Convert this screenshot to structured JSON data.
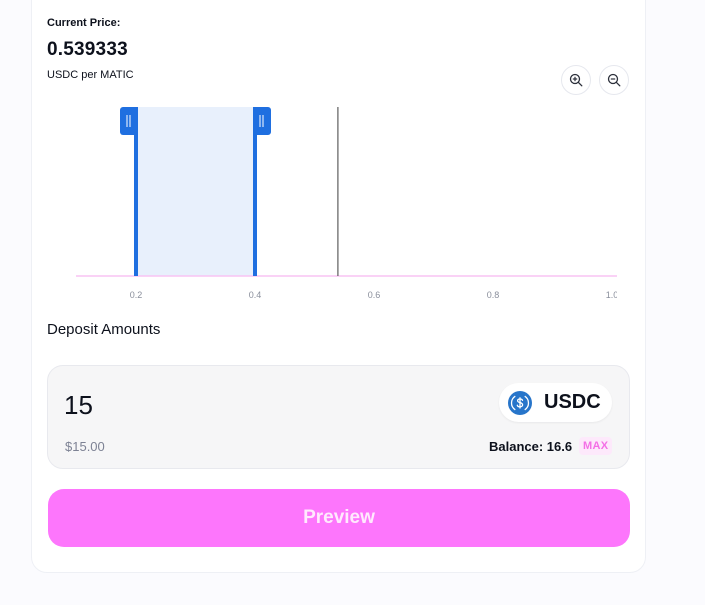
{
  "price": {
    "label": "Current Price:",
    "value": "0.539333",
    "unit": "USDC per MATIC"
  },
  "zoom": {
    "zoom_in_icon": "zoom-in-icon",
    "zoom_out_icon": "zoom-out-icon"
  },
  "chart_data": {
    "type": "line",
    "x_ticks": [
      "0.2",
      "0.4",
      "0.6",
      "0.8",
      "1.0"
    ],
    "xlim": [
      0.1,
      1.0
    ],
    "current_price": 0.539333,
    "range": {
      "min": 0.2,
      "max": 0.4
    },
    "colors": {
      "range_fill": "#e8f0fc",
      "range_handle": "#1f6fe0",
      "current_price_line": "#5d5d5d",
      "axis_line": "#f8c4f4",
      "tick_label": "#8a8f9c"
    }
  },
  "deposit": {
    "title": "Deposit Amounts",
    "amount": "15",
    "token_symbol": "USDC",
    "token_icon": "usdc-icon",
    "usd_value": "$15.00",
    "balance": "Balance: 16.6",
    "max_label": "MAX"
  },
  "actions": {
    "preview_label": "Preview"
  },
  "colors": {
    "accent": "#fd76fc",
    "accent_text": "#ffe9fd",
    "usdc_blue": "#2775ca"
  }
}
